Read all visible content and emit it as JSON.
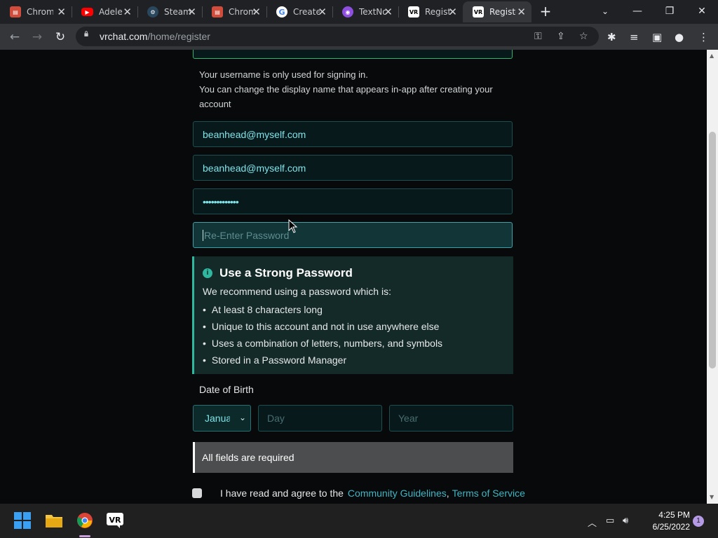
{
  "browser": {
    "tabs": [
      {
        "title": "Chrome",
        "icon": "chrome-store-icon",
        "color": "#d14c3b"
      },
      {
        "title": "Adele",
        "icon": "youtube-icon",
        "color": "#ff0000"
      },
      {
        "title": "Steam",
        "icon": "steam-icon",
        "color": "#1b2838"
      },
      {
        "title": "Chrome",
        "icon": "chrome-store-icon",
        "color": "#d14c3b"
      },
      {
        "title": "Create",
        "icon": "google-icon",
        "color": "#ffffff"
      },
      {
        "title": "TextNow",
        "icon": "textnow-icon",
        "color": "#8e4fe0"
      },
      {
        "title": "Register",
        "icon": "vrchat-icon",
        "color": "#ffffff"
      },
      {
        "title": "Register",
        "icon": "vrchat-icon",
        "color": "#ffffff"
      }
    ],
    "active_tab_index": 7,
    "url_host": "vrchat.com",
    "url_path": "/home/register",
    "window_controls": {
      "minimize": "—",
      "restore": "❐",
      "close": "✕"
    }
  },
  "form": {
    "username_hint": [
      "Your username is only used for signing in.",
      "You can change the display name that appears in-app after creating your",
      "account"
    ],
    "email_value": "beanhead@myself.com",
    "email_confirm_value": "beanhead@myself.com",
    "password_value": "•••••••••••••",
    "reenter_placeholder": "Re-Enter Password",
    "strong_password": {
      "title": "Use a Strong Password",
      "intro": "We recommend using a password which is:",
      "items": [
        "At least 8 characters long",
        "Unique to this account and not in use anywhere else",
        "Uses a combination of letters, numbers, and symbols",
        "Stored in a Password Manager"
      ]
    },
    "dob_label": "Date of Birth",
    "month_value": "January",
    "day_placeholder": "Day",
    "year_placeholder": "Year",
    "required_notice": "All fields are required",
    "agree_text": "I have read and agree to the",
    "community_link": "Community Guidelines",
    "comma": ",",
    "tos_link": "Terms of Service"
  },
  "taskbar": {
    "time": "4:25 PM",
    "date": "6/25/2022",
    "notification_count": "1"
  },
  "colors": {
    "accent": "#2fb8a0",
    "link": "#3fb6c4",
    "field_text": "#7fe3e8"
  }
}
